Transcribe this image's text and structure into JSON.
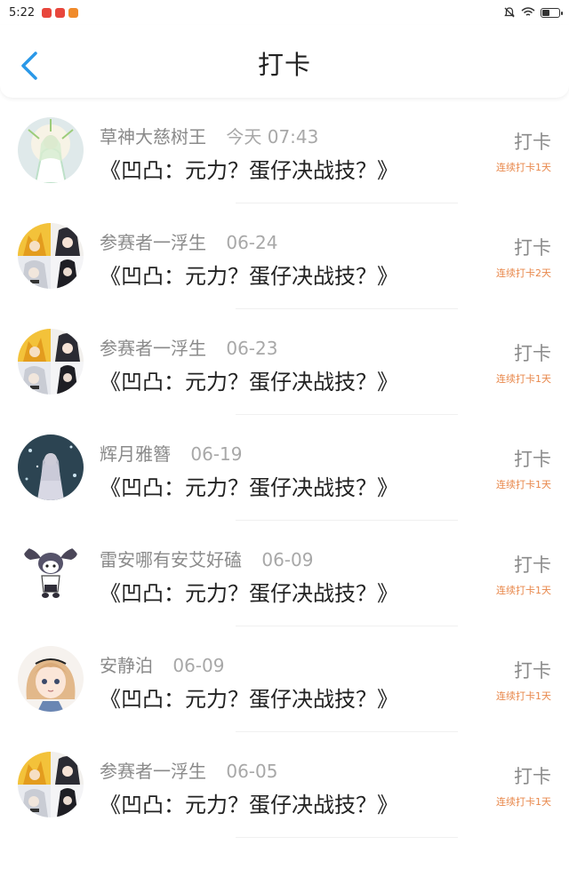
{
  "status_bar": {
    "time": "5:22",
    "battery_level": 0.45
  },
  "header": {
    "title": "打卡"
  },
  "checkin_label": "打卡",
  "list": [
    {
      "user": "草神大慈树王",
      "date": "今天 07:43",
      "work": "《凹凸：元力？蛋仔决战技？》",
      "streak": "连续打卡1天",
      "avatar": "sage"
    },
    {
      "user": "参赛者一浮生",
      "date": "06-24",
      "work": "《凹凸：元力？蛋仔决战技？》",
      "streak": "连续打卡2天",
      "avatar": "grid"
    },
    {
      "user": "参赛者一浮生",
      "date": "06-23",
      "work": "《凹凸：元力？蛋仔决战技？》",
      "streak": "连续打卡1天",
      "avatar": "grid"
    },
    {
      "user": "辉月雅簪",
      "date": "06-19",
      "work": "《凹凸：元力？蛋仔决战技？》",
      "streak": "连续打卡1天",
      "avatar": "night"
    },
    {
      "user": "雷安哪有安艾好磕",
      "date": "06-09",
      "work": "《凹凸：元力？蛋仔决战技？》",
      "streak": "连续打卡1天",
      "avatar": "bunny"
    },
    {
      "user": "安静泊",
      "date": "06-09",
      "work": "《凹凸：元力？蛋仔决战技？》",
      "streak": "连续打卡1天",
      "avatar": "girl"
    },
    {
      "user": "参赛者一浮生",
      "date": "06-05",
      "work": "《凹凸：元力？蛋仔决战技？》",
      "streak": "连续打卡1天",
      "avatar": "grid"
    }
  ]
}
